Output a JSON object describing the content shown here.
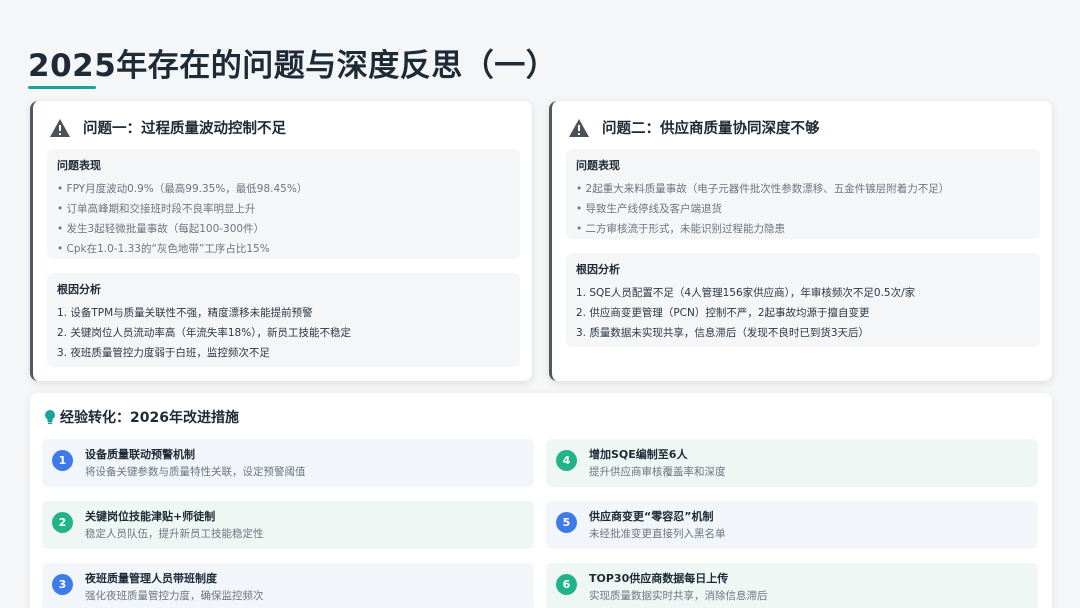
{
  "page": {
    "title": "2025年存在的问题与深度反思（一）"
  },
  "colors": {
    "accent": "#19a39a",
    "blue": "#3e7be8",
    "green": "#21b48a",
    "card_border": "#505860"
  },
  "problems": [
    {
      "icon": "warning-icon",
      "title": "问题一：过程质量波动控制不足",
      "symptoms_title": "问题表现",
      "symptoms": [
        "• FPY月度波动0.9%（最高99.35%，最低98.45%）",
        "• 订单高峰期和交接班时段不良率明显上升",
        "• 发生3起轻微批量事故（每起100-300件）",
        "• Cpk在1.0-1.33的“灰色地带”工序占比15%"
      ],
      "causes_title": "根因分析",
      "causes": [
        "1. 设备TPM与质量关联性不强，精度漂移未能提前预警",
        "2. 关键岗位人员流动率高（年流失率18%），新员工技能不稳定",
        "3. 夜班质量管控力度弱于白班，监控频次不足"
      ]
    },
    {
      "icon": "warning-icon",
      "title": "问题二：供应商质量协同深度不够",
      "symptoms_title": "问题表现",
      "symptoms": [
        "• 2起重大来料质量事故（电子元器件批次性参数漂移、五金件镀层附着力不足）",
        "• 导致生产线停线及客户端退货",
        "• 二方审核流于形式，未能识别过程能力隐患"
      ],
      "causes_title": "根因分析",
      "causes": [
        "1. SQE人员配置不足（4人管理156家供应商），年审核频次不足0.5次/家",
        "2. 供应商变更管理（PCN）控制不严，2起事故均源于擅自变更",
        "3. 质量数据未实现共享，信息滞后（发现不良时已到货3天后）"
      ]
    }
  ],
  "improvements": {
    "icon": "lightbulb-icon",
    "title": "经验转化：2026年改进措施",
    "items": [
      {
        "num": "1",
        "title": "设备质量联动预警机制",
        "desc": "将设备关键参数与质量特性关联，设定预警阈值"
      },
      {
        "num": "2",
        "title": "关键岗位技能津贴+师徒制",
        "desc": "稳定人员队伍，提升新员工技能稳定性"
      },
      {
        "num": "3",
        "title": "夜班质量管理人员带班制度",
        "desc": "强化夜班质量管控力度，确保监控频次"
      },
      {
        "num": "4",
        "title": "增加SQE编制至6人",
        "desc": "提升供应商审核覆盖率和深度"
      },
      {
        "num": "5",
        "title": "供应商变更“零容忍”机制",
        "desc": "未经批准变更直接列入黑名单"
      },
      {
        "num": "6",
        "title": "TOP30供应商数据每日上传",
        "desc": "实现质量数据实时共享，消除信息滞后"
      }
    ]
  }
}
